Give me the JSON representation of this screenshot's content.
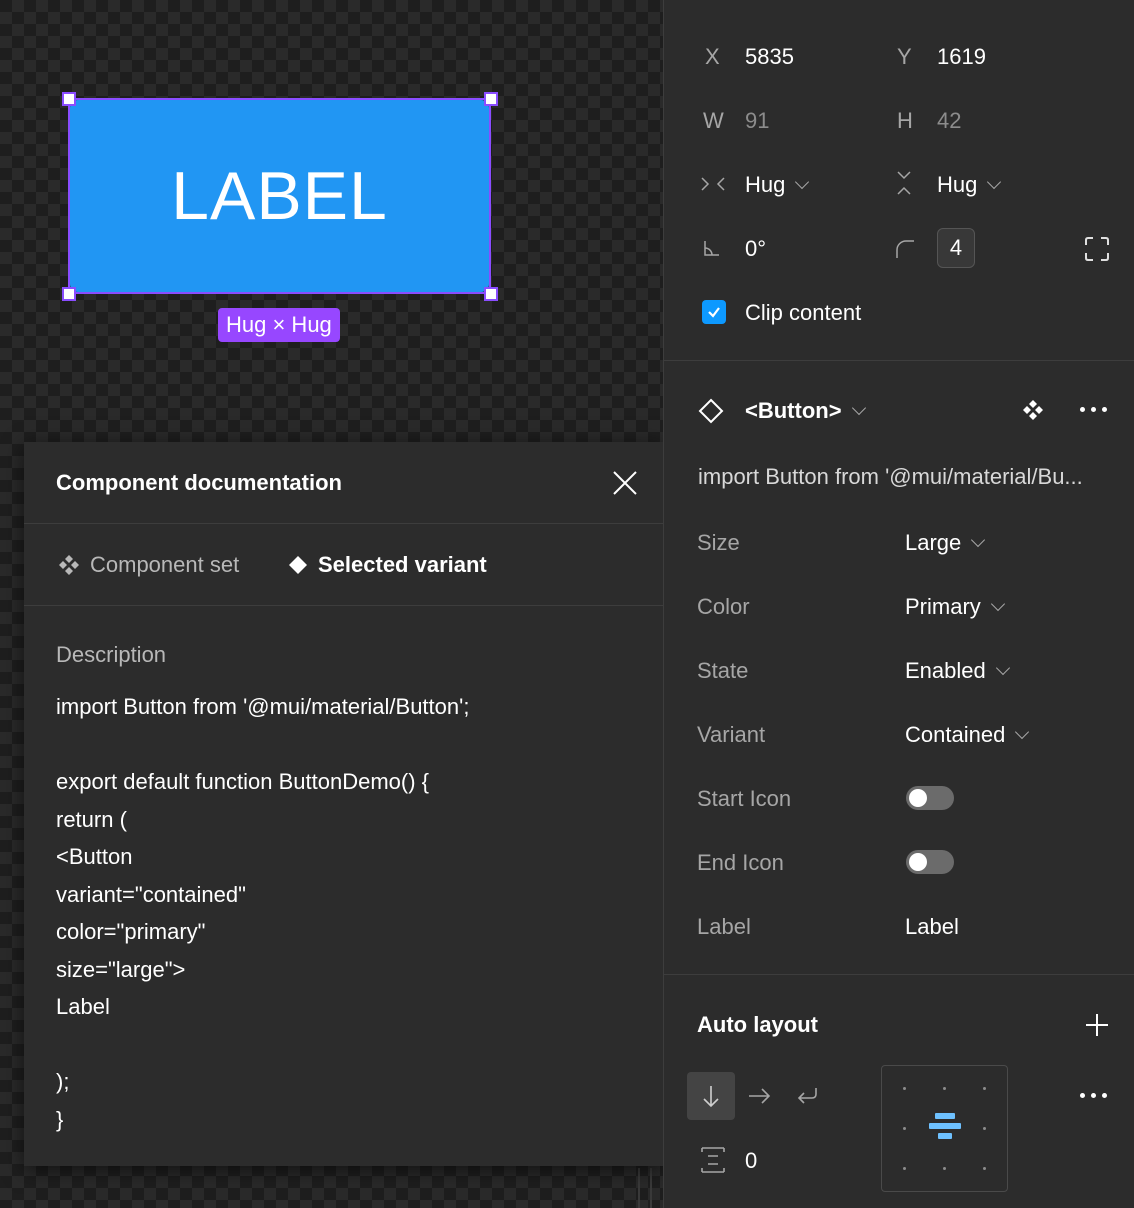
{
  "canvas": {
    "button_text": "LABEL",
    "hug_badge": "Hug × Hug"
  },
  "doc_panel": {
    "title": "Component documentation",
    "tabs": [
      {
        "label": "Component set",
        "active": false
      },
      {
        "label": "Selected variant",
        "active": true
      }
    ],
    "description_label": "Description",
    "code": "import Button from '@mui/material/Button';\n\nexport default function ButtonDemo() {\nreturn (\n<Button\nvariant=\"contained\"\ncolor=\"primary\"\nsize=\"large\">\nLabel\n\n);\n}"
  },
  "props_panel": {
    "x_label": "X",
    "x_value": "5835",
    "y_label": "Y",
    "y_value": "1619",
    "w_label": "W",
    "w_value": "91",
    "h_label": "H",
    "h_value": "42",
    "h_sizing": "Hug",
    "v_sizing": "Hug",
    "rotation": "0°",
    "corner_radius": "4",
    "clip_content_label": "Clip content",
    "clip_content_checked": true,
    "component_name": "<Button>",
    "import_text": "import Button from '@mui/material/Bu...",
    "properties": [
      {
        "label": "Size",
        "value": "Large",
        "type": "select"
      },
      {
        "label": "Color",
        "value": "Primary",
        "type": "select"
      },
      {
        "label": "State",
        "value": "Enabled",
        "type": "select"
      },
      {
        "label": "Variant",
        "value": "Contained",
        "type": "select"
      },
      {
        "label": "Start Icon",
        "type": "toggle",
        "on": false
      },
      {
        "label": "End Icon",
        "type": "toggle",
        "on": false
      },
      {
        "label": "Label",
        "value": "Label",
        "type": "text"
      }
    ],
    "auto_layout_title": "Auto layout",
    "gap_value": "0"
  },
  "colors": {
    "accent_blue": "#0d99ff",
    "selection_purple": "#8a4dff",
    "mui_primary": "#2196f3",
    "badge_purple": "#9747ff"
  }
}
